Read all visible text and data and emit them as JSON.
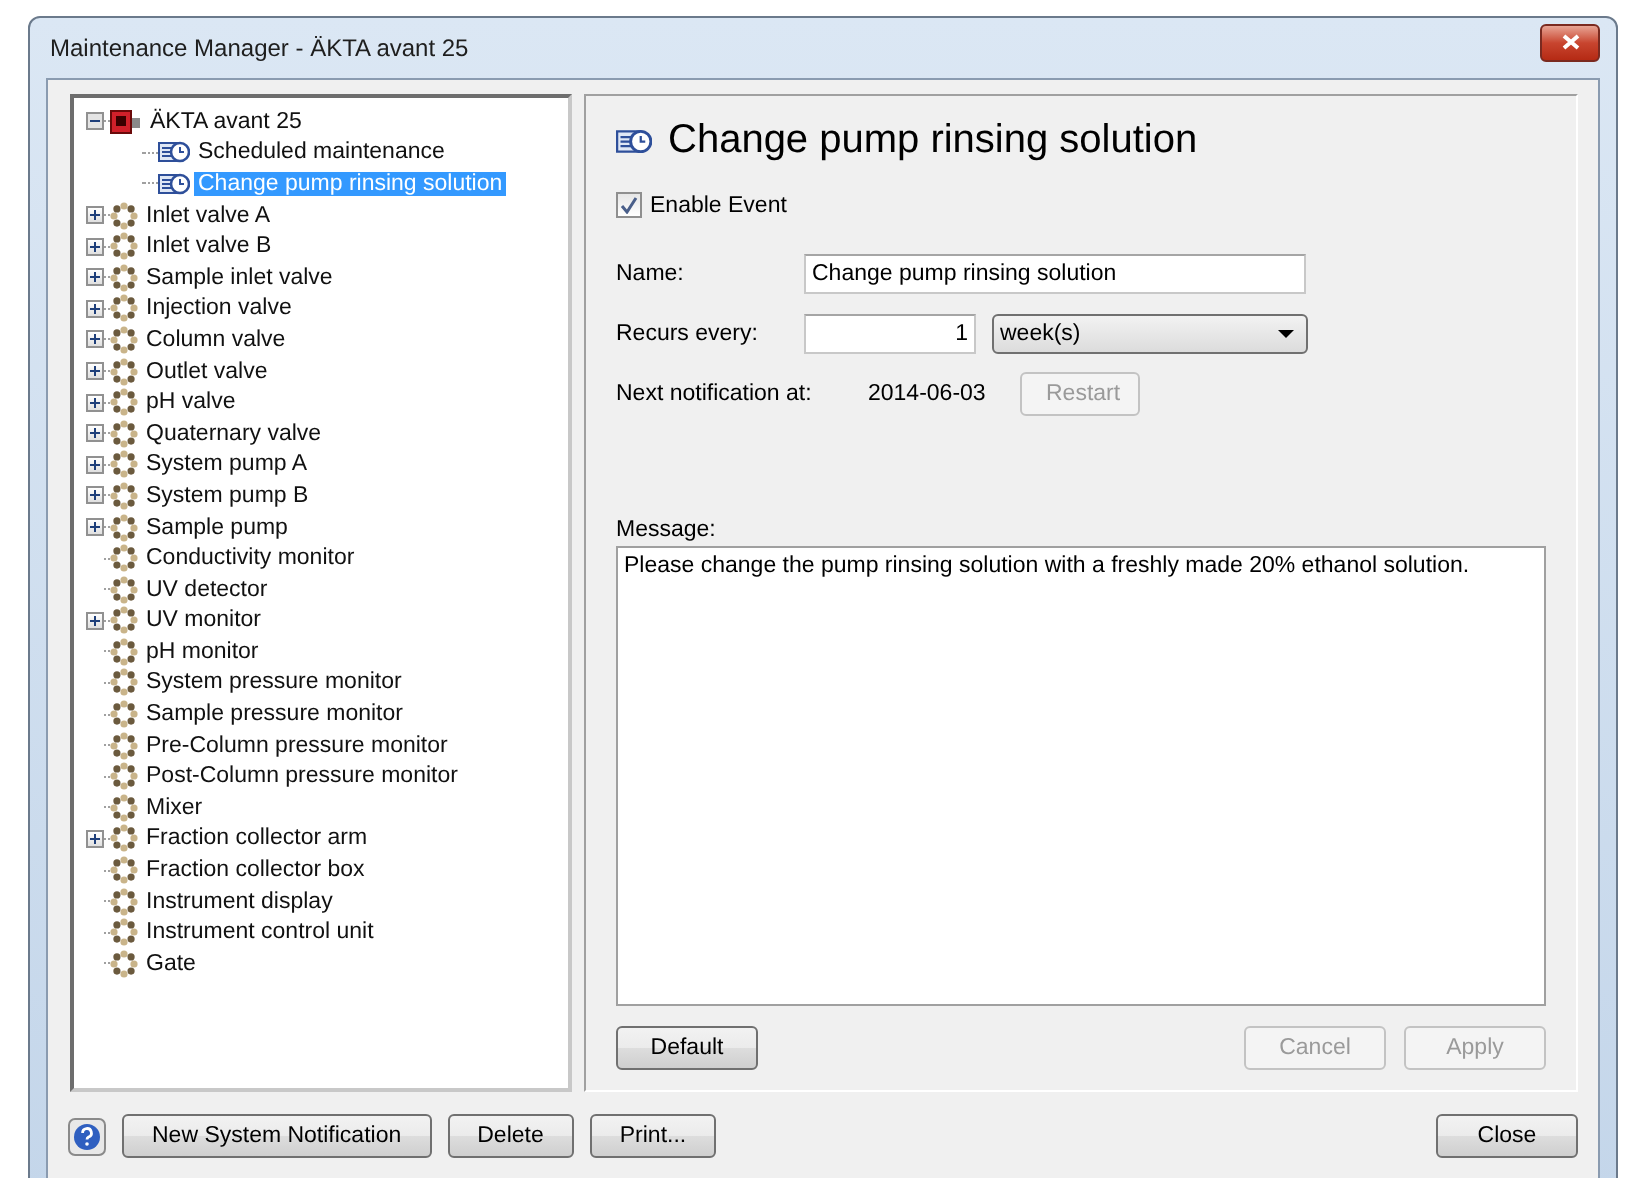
{
  "window": {
    "title": "Maintenance Manager - ÄKTA avant 25"
  },
  "tree": [
    {
      "label": "ÄKTA avant 25",
      "kind": "instrument",
      "expanded": true,
      "selected": false,
      "children": [
        {
          "label": "Scheduled maintenance",
          "kind": "event",
          "selected": false
        },
        {
          "label": "Change pump rinsing solution",
          "kind": "event",
          "selected": true
        }
      ]
    },
    {
      "label": "Inlet valve A",
      "kind": "component",
      "expanded": false,
      "selected": false
    },
    {
      "label": "Inlet valve B",
      "kind": "component",
      "expanded": false,
      "selected": false
    },
    {
      "label": "Sample inlet valve",
      "kind": "component",
      "expanded": false,
      "selected": false
    },
    {
      "label": "Injection valve",
      "kind": "component",
      "expanded": false,
      "selected": false
    },
    {
      "label": "Column valve",
      "kind": "component",
      "expanded": false,
      "selected": false
    },
    {
      "label": "Outlet valve",
      "kind": "component",
      "expanded": false,
      "selected": false
    },
    {
      "label": "pH valve",
      "kind": "component",
      "expanded": false,
      "selected": false
    },
    {
      "label": "Quaternary valve",
      "kind": "component",
      "expanded": false,
      "selected": false
    },
    {
      "label": "System pump A",
      "kind": "component",
      "expanded": false,
      "selected": false
    },
    {
      "label": "System pump B",
      "kind": "component",
      "expanded": false,
      "selected": false
    },
    {
      "label": "Sample pump",
      "kind": "component",
      "expanded": false,
      "selected": false
    },
    {
      "label": "Conductivity monitor",
      "kind": "component",
      "selected": false
    },
    {
      "label": "UV detector",
      "kind": "component",
      "selected": false
    },
    {
      "label": "UV monitor",
      "kind": "component",
      "expanded": false,
      "selected": false
    },
    {
      "label": "pH monitor",
      "kind": "component",
      "selected": false
    },
    {
      "label": "System pressure monitor",
      "kind": "component",
      "selected": false
    },
    {
      "label": "Sample pressure monitor",
      "kind": "component",
      "selected": false
    },
    {
      "label": "Pre-Column pressure monitor",
      "kind": "component",
      "selected": false
    },
    {
      "label": "Post-Column pressure monitor",
      "kind": "component",
      "selected": false
    },
    {
      "label": "Mixer",
      "kind": "component",
      "selected": false
    },
    {
      "label": "Fraction collector arm",
      "kind": "component",
      "expanded": false,
      "selected": false
    },
    {
      "label": "Fraction collector box",
      "kind": "component",
      "selected": false
    },
    {
      "label": "Instrument display",
      "kind": "component",
      "selected": false
    },
    {
      "label": "Instrument control unit",
      "kind": "component",
      "selected": false
    },
    {
      "label": "Gate",
      "kind": "component",
      "selected": false
    }
  ],
  "detail": {
    "heading": "Change pump rinsing solution",
    "enable": {
      "label": "Enable Event",
      "checked": true
    },
    "name": {
      "label": "Name:",
      "value": "Change pump rinsing solution"
    },
    "recurs": {
      "label": "Recurs every:",
      "value": "1",
      "unit": "week(s)"
    },
    "next": {
      "label": "Next notification at:",
      "value": "2014-06-03",
      "restart": {
        "label": "Restart",
        "disabled": true
      }
    },
    "message": {
      "label": "Message:",
      "value": "Please change the pump rinsing solution with a freshly made 20% ethanol solution."
    },
    "buttons_left": [
      {
        "label": "Default",
        "disabled": false
      }
    ],
    "buttons_right": [
      {
        "label": "Cancel",
        "disabled": true
      },
      {
        "label": "Apply",
        "disabled": true
      }
    ]
  },
  "footer": {
    "left": [
      "New System Notification",
      "Delete",
      "Print..."
    ],
    "right": [
      "Close"
    ]
  }
}
